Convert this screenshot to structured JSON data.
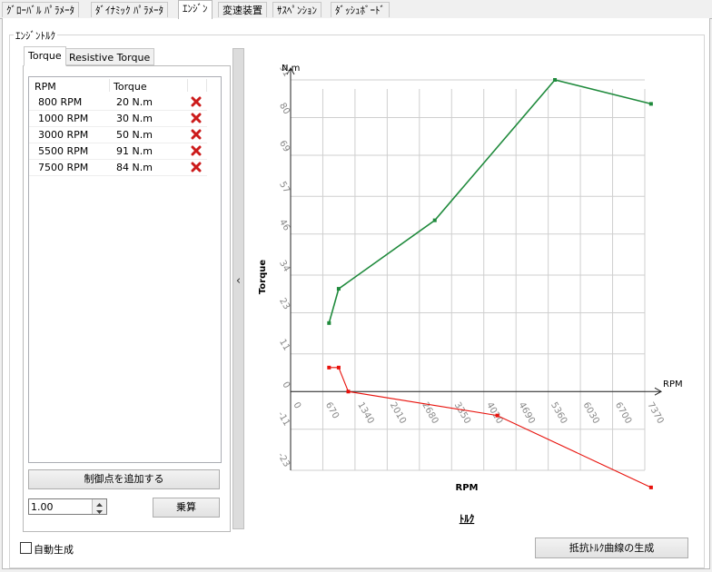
{
  "top_tabs": [
    {
      "label": "ｸﾞﾛｰﾊﾞﾙ ﾊﾟﾗﾒｰﾀ"
    },
    {
      "label": "ﾀﾞｲﾅﾐｯｸ ﾊﾟﾗﾒｰﾀ"
    },
    {
      "label": "ｴﾝｼﾞﾝ"
    },
    {
      "label": "変速装置"
    },
    {
      "label": "ｻｽﾍﾟﾝｼｮﾝ"
    },
    {
      "label": "ﾀﾞｯｼｭﾎﾞｰﾄﾞ"
    }
  ],
  "group_title": "ｴﾝｼﾞﾝﾄﾙｸ",
  "inner_tabs": [
    {
      "label": "Torque"
    },
    {
      "label": "Resistive Torque"
    }
  ],
  "table": {
    "headers": [
      "RPM",
      "Torque"
    ],
    "rows": [
      {
        "rpm": "800 RPM",
        "torque": "20 N.m"
      },
      {
        "rpm": "1000 RPM",
        "torque": "30 N.m"
      },
      {
        "rpm": "3000 RPM",
        "torque": "50 N.m"
      },
      {
        "rpm": "5500 RPM",
        "torque": "91 N.m"
      },
      {
        "rpm": "7500 RPM",
        "torque": "84 N.m"
      }
    ]
  },
  "add_point_label": "制御点を追加する",
  "multiplier_value": "1.00",
  "multiply_label": "乗算",
  "auto_generate_label": "自動生成",
  "generate_resistive_label": "抵抗ﾄﾙｸ曲線の生成",
  "splitter_glyph": "‹",
  "colors": {
    "torque": "#1f8a3c",
    "resistive": "#e8120c",
    "delete": "#cc1b1b"
  },
  "chart_data": {
    "type": "line",
    "title": "ﾄﾙｸ",
    "xlabel": "RPM",
    "ylabel": "Torque",
    "x_unit": "RPM",
    "y_unit": "N.m",
    "x_ticks": [
      "0",
      "670",
      "1340",
      "2010",
      "2680",
      "3350",
      "4020",
      "4690",
      "5360",
      "6030",
      "6700",
      "7370"
    ],
    "y_ticks": [
      "-23",
      "-11",
      "0",
      "11",
      "23",
      "34",
      "46",
      "57",
      "69",
      "80",
      "91"
    ],
    "xlim": [
      0,
      7370
    ],
    "ylim": [
      -23,
      91
    ],
    "series": [
      {
        "name": "Torque",
        "color": "#1f8a3c",
        "x": [
          800,
          1000,
          3000,
          5500,
          7500
        ],
        "y": [
          20,
          30,
          50,
          91,
          84
        ]
      },
      {
        "name": "Resistive Torque",
        "color": "#e8120c",
        "x": [
          800,
          1000,
          1200,
          4300,
          7500
        ],
        "y": [
          7,
          7,
          0,
          -7,
          -28
        ]
      }
    ]
  }
}
